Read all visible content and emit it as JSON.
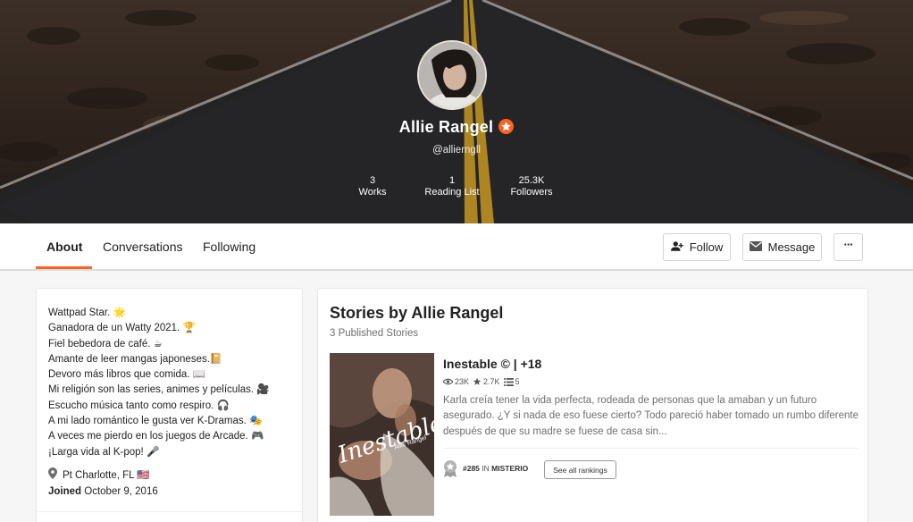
{
  "profile": {
    "name": "Allie Rangel",
    "handle": "@allierngll",
    "stats": [
      {
        "value": "3",
        "label": "Works"
      },
      {
        "value": "1",
        "label": "Reading List"
      },
      {
        "value": "25.3K",
        "label": "Followers"
      }
    ]
  },
  "tabs": [
    {
      "label": "About",
      "active": true
    },
    {
      "label": "Conversations",
      "active": false
    },
    {
      "label": "Following",
      "active": false
    }
  ],
  "actions": {
    "follow_label": "Follow",
    "message_label": "Message",
    "more_label": "···"
  },
  "about": {
    "bio_lines": [
      "Wattpad Star. 🌟",
      "Ganadora de un Watty 2021. 🏆",
      "Fiel bebedora de café. ☕",
      "Amante de leer mangas japoneses.📔",
      "Devoro más libros que comida. 📖",
      "Mi religión son las series, animes y películas. 🎥",
      "Escucho música tanto como respiro. 🎧",
      "A mi lado romántico le gusta ver K-Dramas. 🎭",
      "A veces me pierdo en los juegos de Arcade. 🎮",
      "¡Larga vida al K-pop! 🎤"
    ],
    "location": "Pt Charlotte, FL 🇺🇸",
    "joined_label": "Joined",
    "joined_date": "October 9, 2016"
  },
  "stories": {
    "title": "Stories by Allie Rangel",
    "subtitle": "3 Published Stories",
    "items": [
      {
        "title": "Inestable © | +18",
        "reads": "23K",
        "votes": "2.7K",
        "parts": "5",
        "description": "Karla creía tener la vida perfecta, rodeada de personas que la amaban y un futuro asegurado. ¿Y si nada de eso fuese cierto? Todo pareció haber tomado un rumbo diferente después de que su madre se fuese de casa sin...",
        "cover_title": "Inestable",
        "cover_author": "Allie Rangel",
        "rank": "#285",
        "rank_in": "IN",
        "rank_category": "MISTERIO",
        "rankings_button": "See all rankings"
      }
    ]
  },
  "colors": {
    "accent": "#ff6122",
    "text": "#222222",
    "muted": "#6f6f6f"
  }
}
